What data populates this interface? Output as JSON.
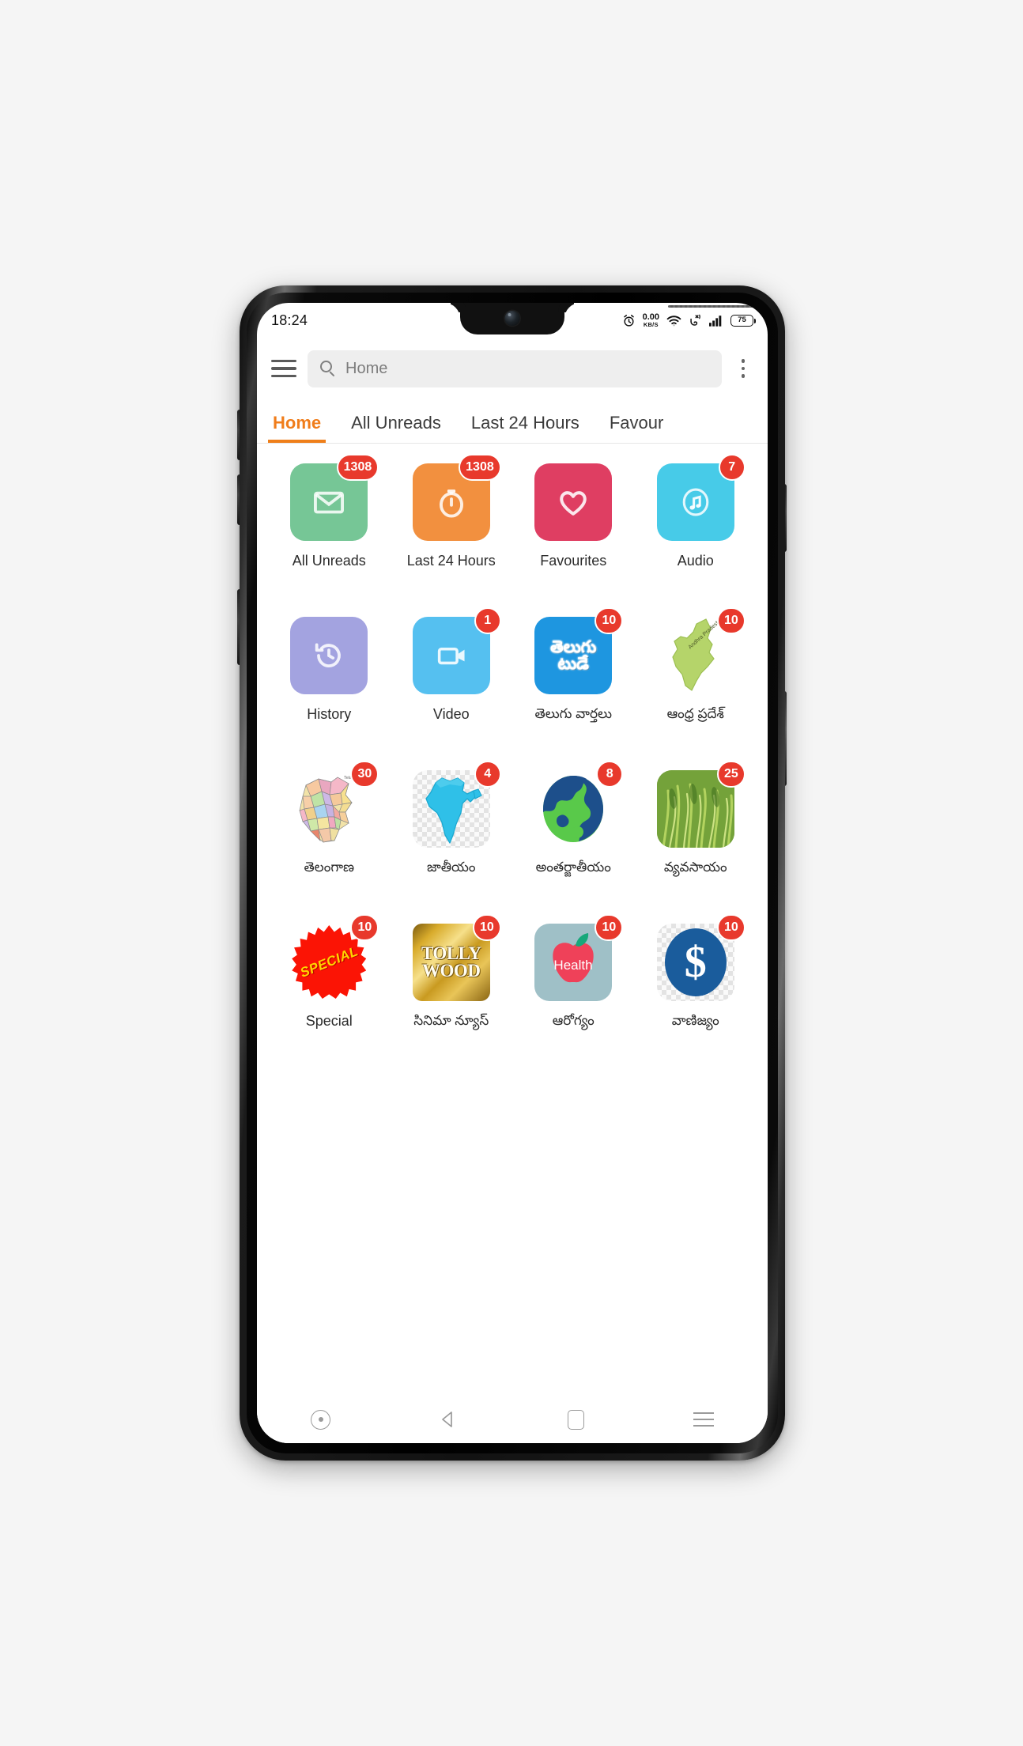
{
  "status_bar": {
    "time": "18:24",
    "alarm_icon": "alarm-clock-icon",
    "net_speed_value": "0.00",
    "net_speed_unit": "KB/S",
    "wifi_icon": "wifi-icon",
    "vibrate_icon": "vibrate-call-icon",
    "signal_icon": "signal-bars-icon",
    "battery_level": "75"
  },
  "toolbar": {
    "menu_icon": "hamburger-menu-icon",
    "search_icon": "search-icon",
    "search_placeholder": "Home",
    "search_value": "",
    "overflow_icon": "kebab-menu-icon"
  },
  "tabs": {
    "active_index": 0,
    "items": [
      {
        "label": "Home"
      },
      {
        "label": "All Unreads"
      },
      {
        "label": "Last 24 Hours"
      },
      {
        "label": "Favour"
      }
    ]
  },
  "grid": {
    "items": [
      {
        "label": "All Unreads",
        "badge": "1308",
        "icon": "envelope-icon",
        "color": "#76c696"
      },
      {
        "label": "Last 24 Hours",
        "badge": "1308",
        "icon": "stopwatch-icon",
        "color": "#f2903f"
      },
      {
        "label": "Favourites",
        "badge": "",
        "icon": "heart-icon",
        "color": "#df3e62"
      },
      {
        "label": "Audio",
        "badge": "7",
        "icon": "music-note-icon",
        "color": "#47cbe8"
      },
      {
        "label": "History",
        "badge": "",
        "icon": "history-clock-icon",
        "color": "#a3a3e0"
      },
      {
        "label": "Video",
        "badge": "1",
        "icon": "video-camera-icon",
        "color": "#55c0f0"
      },
      {
        "label": "తెలుగు వార్తలు",
        "badge": "10",
        "icon": "telugu-today-logo-icon",
        "color": "#1e96e0"
      },
      {
        "label": "ఆంధ్ర ప్రదేశ్",
        "badge": "10",
        "icon": "andhra-pradesh-map-icon",
        "color": "transparent"
      },
      {
        "label": "తెలంగాణ",
        "badge": "30",
        "icon": "telangana-map-icon",
        "color": "transparent"
      },
      {
        "label": "జాతీయం",
        "badge": "4",
        "icon": "india-map-icon",
        "color": "transparent"
      },
      {
        "label": "అంతర్జాతీయం",
        "badge": "8",
        "icon": "globe-icon",
        "color": "transparent"
      },
      {
        "label": "వ్యవసాయం",
        "badge": "25",
        "icon": "crops-photo-icon",
        "color": "transparent"
      },
      {
        "label": "Special",
        "badge": "10",
        "icon": "special-starburst-icon",
        "color": "transparent"
      },
      {
        "label": "సినిమా న్యూస్",
        "badge": "10",
        "icon": "tollywood-logo-icon",
        "color": "transparent"
      },
      {
        "label": "ఆరోగ్యం",
        "badge": "10",
        "icon": "health-apple-icon",
        "color": "#9fc0c7"
      },
      {
        "label": "వాణిజ్యం",
        "badge": "10",
        "icon": "dollar-sign-icon",
        "color": "transparent"
      }
    ],
    "special_star_text": "SPECIAL",
    "tollywood_line1": "TOLLY",
    "tollywood_line2": "WOOD",
    "telugu_today_line1": "తెలుగు",
    "telugu_today_line2": "టుడే",
    "health_text": "Health",
    "dollar_text": "$"
  },
  "navbar": {
    "items": [
      {
        "icon": "recent-dot-icon"
      },
      {
        "icon": "back-triangle-icon"
      },
      {
        "icon": "home-square-icon"
      },
      {
        "icon": "menu-lines-icon"
      }
    ]
  },
  "colors": {
    "accent": "#ef7f1a",
    "badge": "#e8392c",
    "screen_bg": "#ffffff",
    "page_bg": "#f5f5f5"
  }
}
